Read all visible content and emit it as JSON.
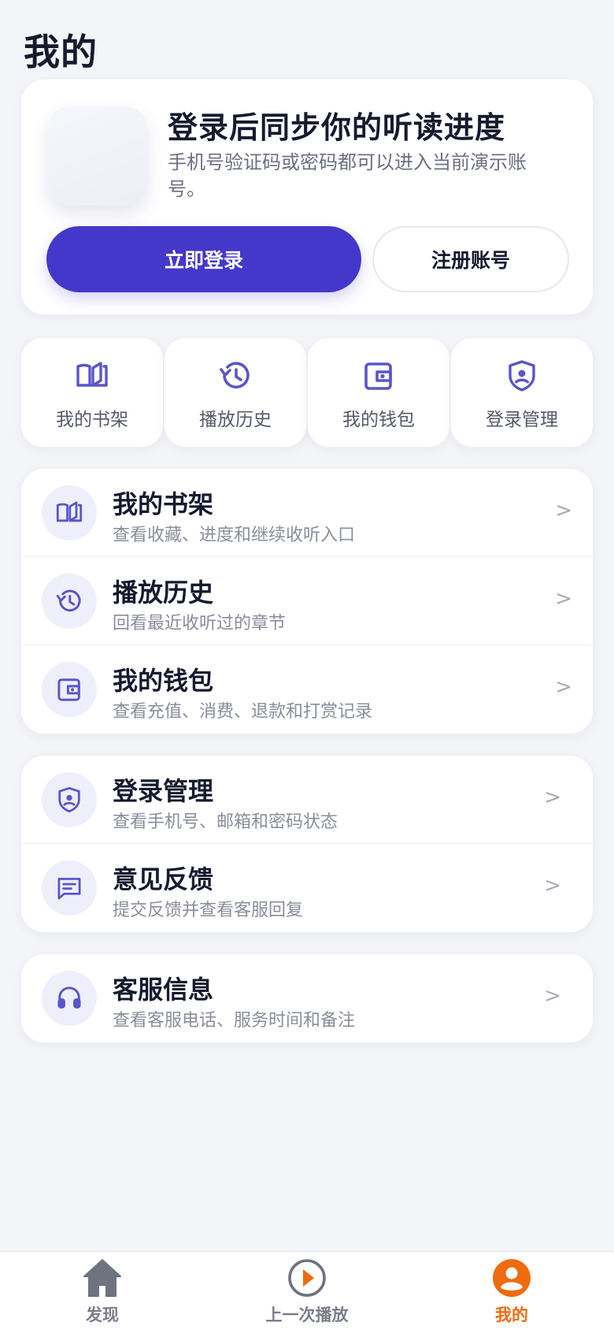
{
  "page": {
    "title": "我的"
  },
  "login": {
    "title": "登录后同步你的听读进度",
    "description": "手机号验证码或密码都可以进入当前演示账号。",
    "login_label": "立即登录",
    "register_label": "注册账号"
  },
  "quick": [
    {
      "label": "我的书架",
      "icon": "bookshelf-icon"
    },
    {
      "label": "播放历史",
      "icon": "history-icon"
    },
    {
      "label": "我的钱包",
      "icon": "wallet-icon"
    },
    {
      "label": "登录管理",
      "icon": "shield-user-icon"
    }
  ],
  "list1": [
    {
      "title": "我的书架",
      "subtitle": "查看收藏、进度和继续收听入口",
      "icon": "bookshelf-icon"
    },
    {
      "title": "播放历史",
      "subtitle": "回看最近收听过的章节",
      "icon": "history-icon"
    },
    {
      "title": "我的钱包",
      "subtitle": "查看充值、消费、退款和打赏记录",
      "icon": "wallet-icon"
    }
  ],
  "list2": [
    {
      "title": "登录管理",
      "subtitle": "查看手机号、邮箱和密码状态",
      "icon": "shield-user-icon"
    },
    {
      "title": "意见反馈",
      "subtitle": "提交反馈并查看客服回复",
      "icon": "feedback-icon"
    }
  ],
  "list3": [
    {
      "title": "客服信息",
      "subtitle": "查看客服电话、服务时间和备注",
      "icon": "headset-icon"
    }
  ],
  "chevron": ">",
  "nav": {
    "discover": "发现",
    "last_play": "上一次播放",
    "mine": "我的"
  },
  "colors": {
    "accent": "#4338ca",
    "icon": "#5b55c9",
    "active_tab": "#f06a0f"
  }
}
